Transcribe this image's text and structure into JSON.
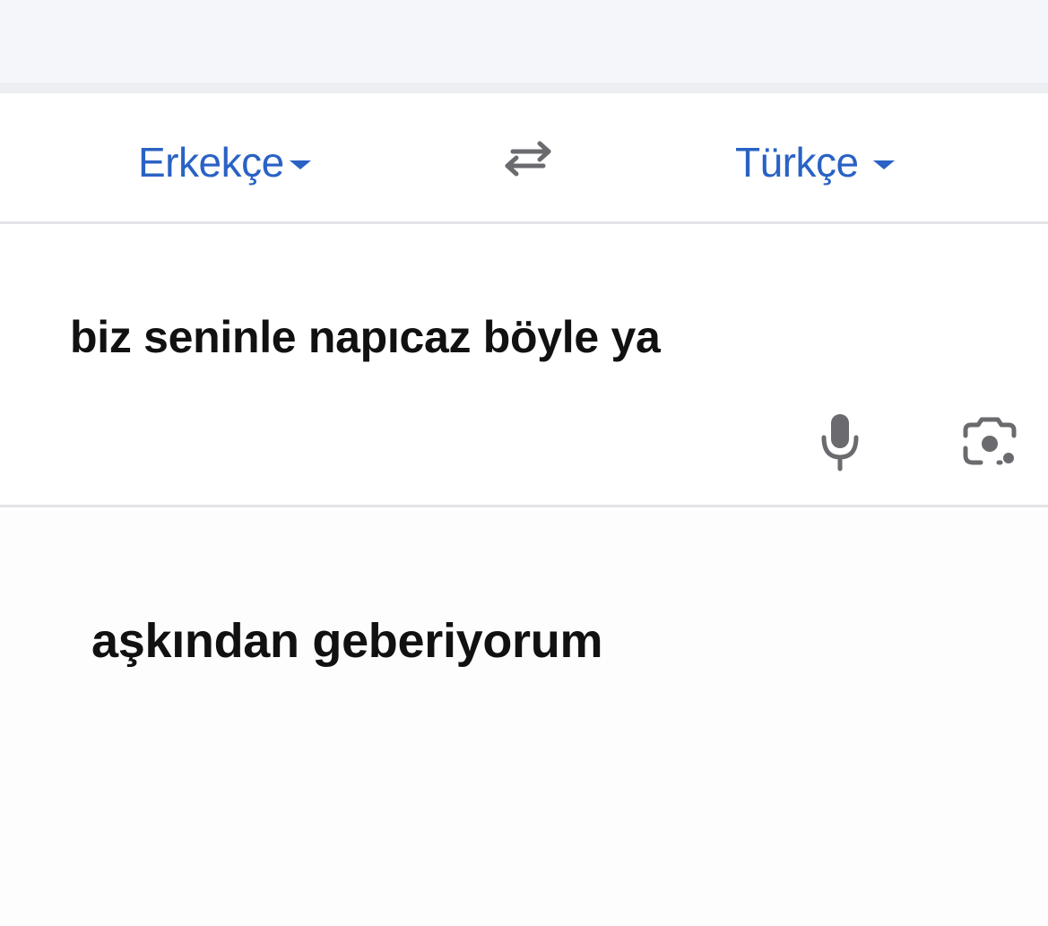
{
  "language_bar": {
    "source_language": "Erkekçe",
    "target_language": "Türkçe"
  },
  "input": {
    "text": "biz seninle napıcaz böyle ya"
  },
  "output": {
    "text": "aşkından geberiyorum"
  },
  "icons": {
    "source_dropdown": "chevron-down-icon",
    "target_dropdown": "chevron-down-icon",
    "swap": "swap-arrows-icon",
    "mic": "microphone-icon",
    "camera": "camera-lens-icon"
  },
  "colors": {
    "accent": "#2a62c4",
    "icon_gray": "#6b6b6f",
    "text": "#111111"
  }
}
